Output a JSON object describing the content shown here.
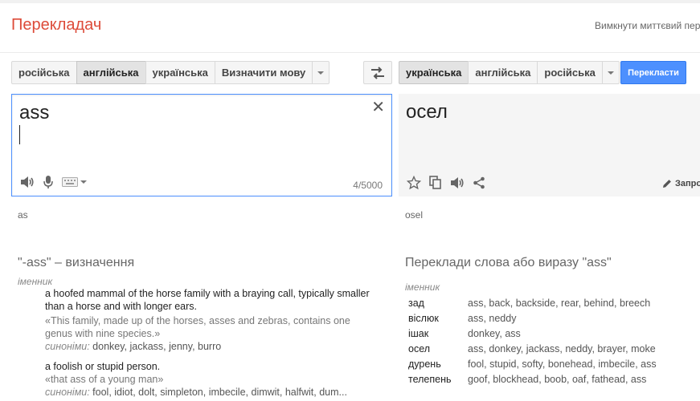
{
  "header": {
    "app_title": "Перекладач",
    "instant_toggle": "Вимкнути миттєвий пер"
  },
  "source_languages": [
    "російська",
    "англійська",
    "українська",
    "Визначити мову"
  ],
  "target_languages": [
    "українська",
    "англійська",
    "російська"
  ],
  "translate_button": "Перекласти",
  "source": {
    "text": "ass",
    "char_count": "4/5000",
    "transliteration": "as"
  },
  "target": {
    "text": "осел",
    "suggest_label": "Запро",
    "transliteration": "osel"
  },
  "definitions": {
    "title": "\"-ass\" – визначення",
    "pos": "іменник",
    "synonyms_label": "синоніми:",
    "items": [
      {
        "text": "a hoofed mammal of the horse family with a braying call, typically smaller than a horse and with longer ears.",
        "example": "«This family, made up of the horses, asses and zebras, contains one genus with nine species.»",
        "synonyms": "donkey, jackass, jenny, burro"
      },
      {
        "text": "a foolish or stupid person.",
        "example": "«that ass of a young man»",
        "synonyms": "fool, idiot, dolt, simpleton, imbecile, dimwit, halfwit, dum..."
      }
    ]
  },
  "translations": {
    "title": "Переклади слова або виразу \"ass\"",
    "pos": "іменник",
    "rows": [
      {
        "word": "зад",
        "back": "ass, back, backside, rear, behind, breech"
      },
      {
        "word": "віслюк",
        "back": "ass, neddy"
      },
      {
        "word": "ішак",
        "back": "donkey, ass"
      },
      {
        "word": "осел",
        "back": "ass, donkey, jackass, neddy, brayer, moke"
      },
      {
        "word": "дурень",
        "back": "fool, stupid, softy, bonehead, imbecile, ass"
      },
      {
        "word": "телепень",
        "back": "goof, blockhead, boob, oaf, fathead, ass"
      }
    ]
  },
  "colors": {
    "brand": "#dd4b39",
    "accent": "#4d90fe"
  }
}
